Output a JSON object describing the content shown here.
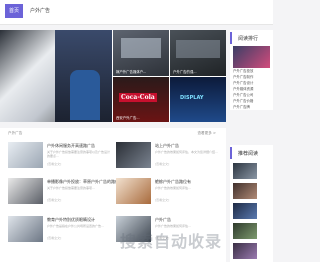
{
  "nav": {
    "home": "首页",
    "item": "户外广告"
  },
  "hero": {
    "captions": [
      "嫁户外广告媒体户...",
      "户外广告的强...",
      "西安户外广告..."
    ],
    "signs": [
      "Coca-Cola",
      "DISPLAY"
    ]
  },
  "sidebar": {
    "title": "阅读排行",
    "items": [
      "户外广告投放",
      "户外广告制作",
      "户外广告设计",
      "户外媒体资源",
      "户外广告公司",
      "户外广告价格",
      "户外广告牌"
    ]
  },
  "main": {
    "header": "户外广告",
    "more": "查看更多 >",
    "articles": [
      {
        "title": "户外休闲服务开高速路广告",
        "desc": "关于户外广告投放需要注意的事项以及广告设计的要点...",
        "tag": "[查看全文]"
      },
      {
        "title": "站上户外广告",
        "desc": "户外广告的效果如何评估，本文为您详细介绍...",
        "tag": "[查看全文]"
      },
      {
        "title": "单播影像户外投放：草原户外广告的路位互动",
        "desc": "关于户外广告投放需要注意的事项...",
        "tag": "[查看全文]"
      },
      {
        "title": "蟾蜍户外广告路位有",
        "desc": "户外广告的效果如何评估...",
        "tag": "[查看全文]"
      },
      {
        "title": "教育户外特别优质眼睛设计",
        "desc": "户外广告是指在户外公共场所设置的广告...",
        "tag": "[查看全文]"
      },
      {
        "title": "户外广告",
        "desc": "户外广告的效果如何评估...",
        "tag": "[查看全文]"
      }
    ]
  },
  "recommend": {
    "title": "推荐阅读"
  },
  "watermark": "搜索自动收录"
}
